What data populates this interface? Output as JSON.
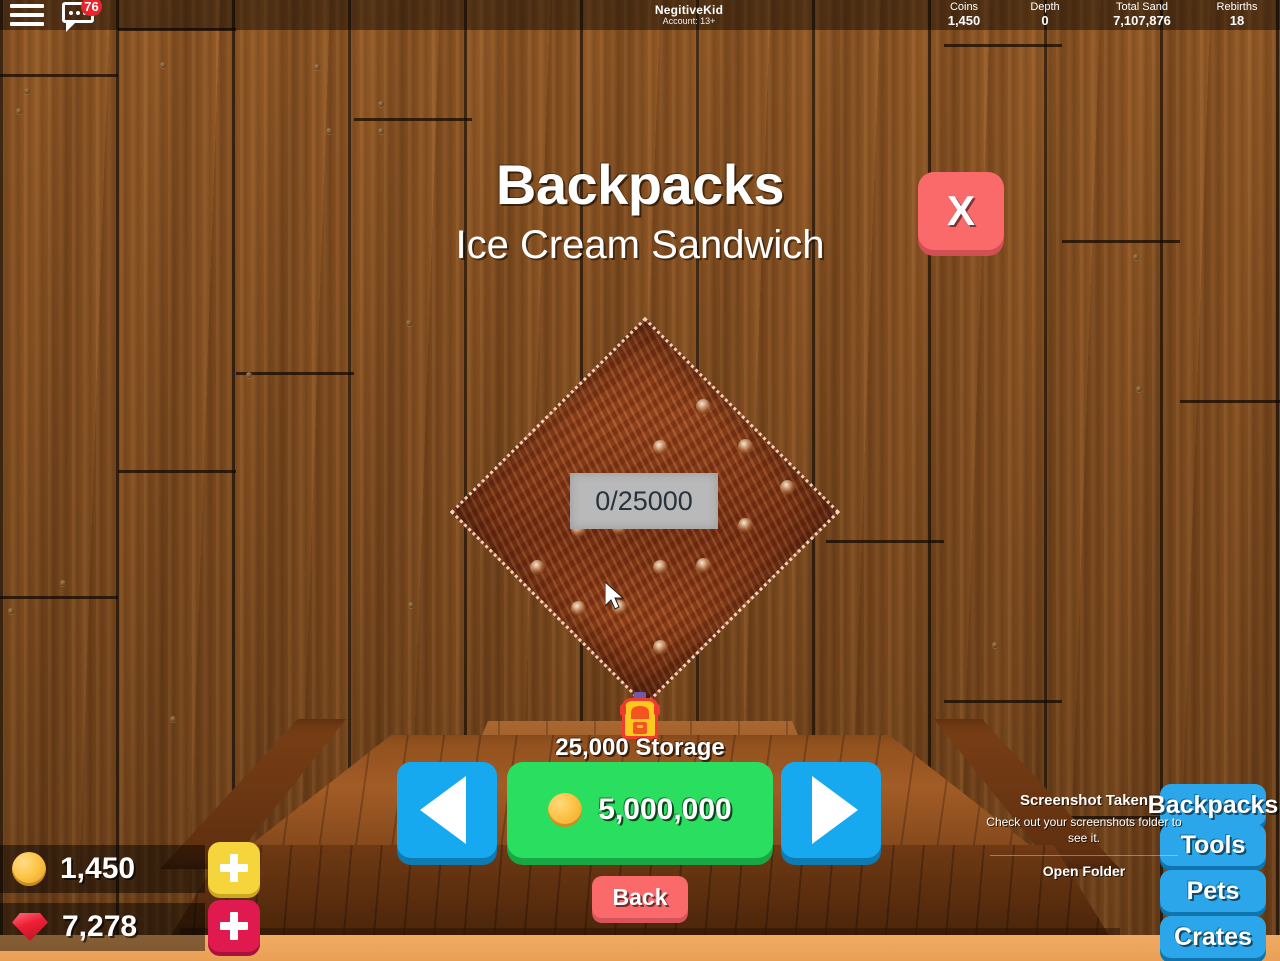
{
  "topbar": {
    "menu_icon": "hamburger-menu-icon",
    "chat_icon": "chat-bubble-icon",
    "chat_badge": "76",
    "account": {
      "username": "NegitiveKid",
      "age_rating": "Account: 13+"
    },
    "stats": [
      {
        "label": "Coins",
        "value": "1,450"
      },
      {
        "label": "Depth",
        "value": "0"
      },
      {
        "label": "Total Sand",
        "value": "7,107,876"
      },
      {
        "label": "Rebirths",
        "value": "18"
      }
    ]
  },
  "panel": {
    "title": "Backpacks",
    "subtitle": "Ice Cream Sandwich",
    "close_label": "X",
    "capacity_text": "0/25000",
    "storage_label": "25,000 Storage",
    "price": "5,000,000",
    "prev_label": "◀",
    "next_label": "▶",
    "back_label": "Back"
  },
  "currency": {
    "coins": "1,450",
    "gems": "7,278",
    "coins_add_label": "+",
    "gems_add_label": "+"
  },
  "side_menu": {
    "items": [
      {
        "label": "Backpacks"
      },
      {
        "label": "Tools"
      },
      {
        "label": "Pets"
      },
      {
        "label": "Crates"
      }
    ]
  },
  "toast": {
    "title": "Screenshot Taken",
    "body": "Check out your screenshots folder to see it.",
    "action": "Open Folder"
  },
  "colors": {
    "accent_blue": "#16a9f0",
    "buy_green": "#2ade5f",
    "close_red": "#fa6a6a",
    "badge_red": "#e8252c",
    "coin_gold": "#fcc144",
    "gem_red": "#ef2036",
    "side_blue": "#2ba6ea"
  }
}
